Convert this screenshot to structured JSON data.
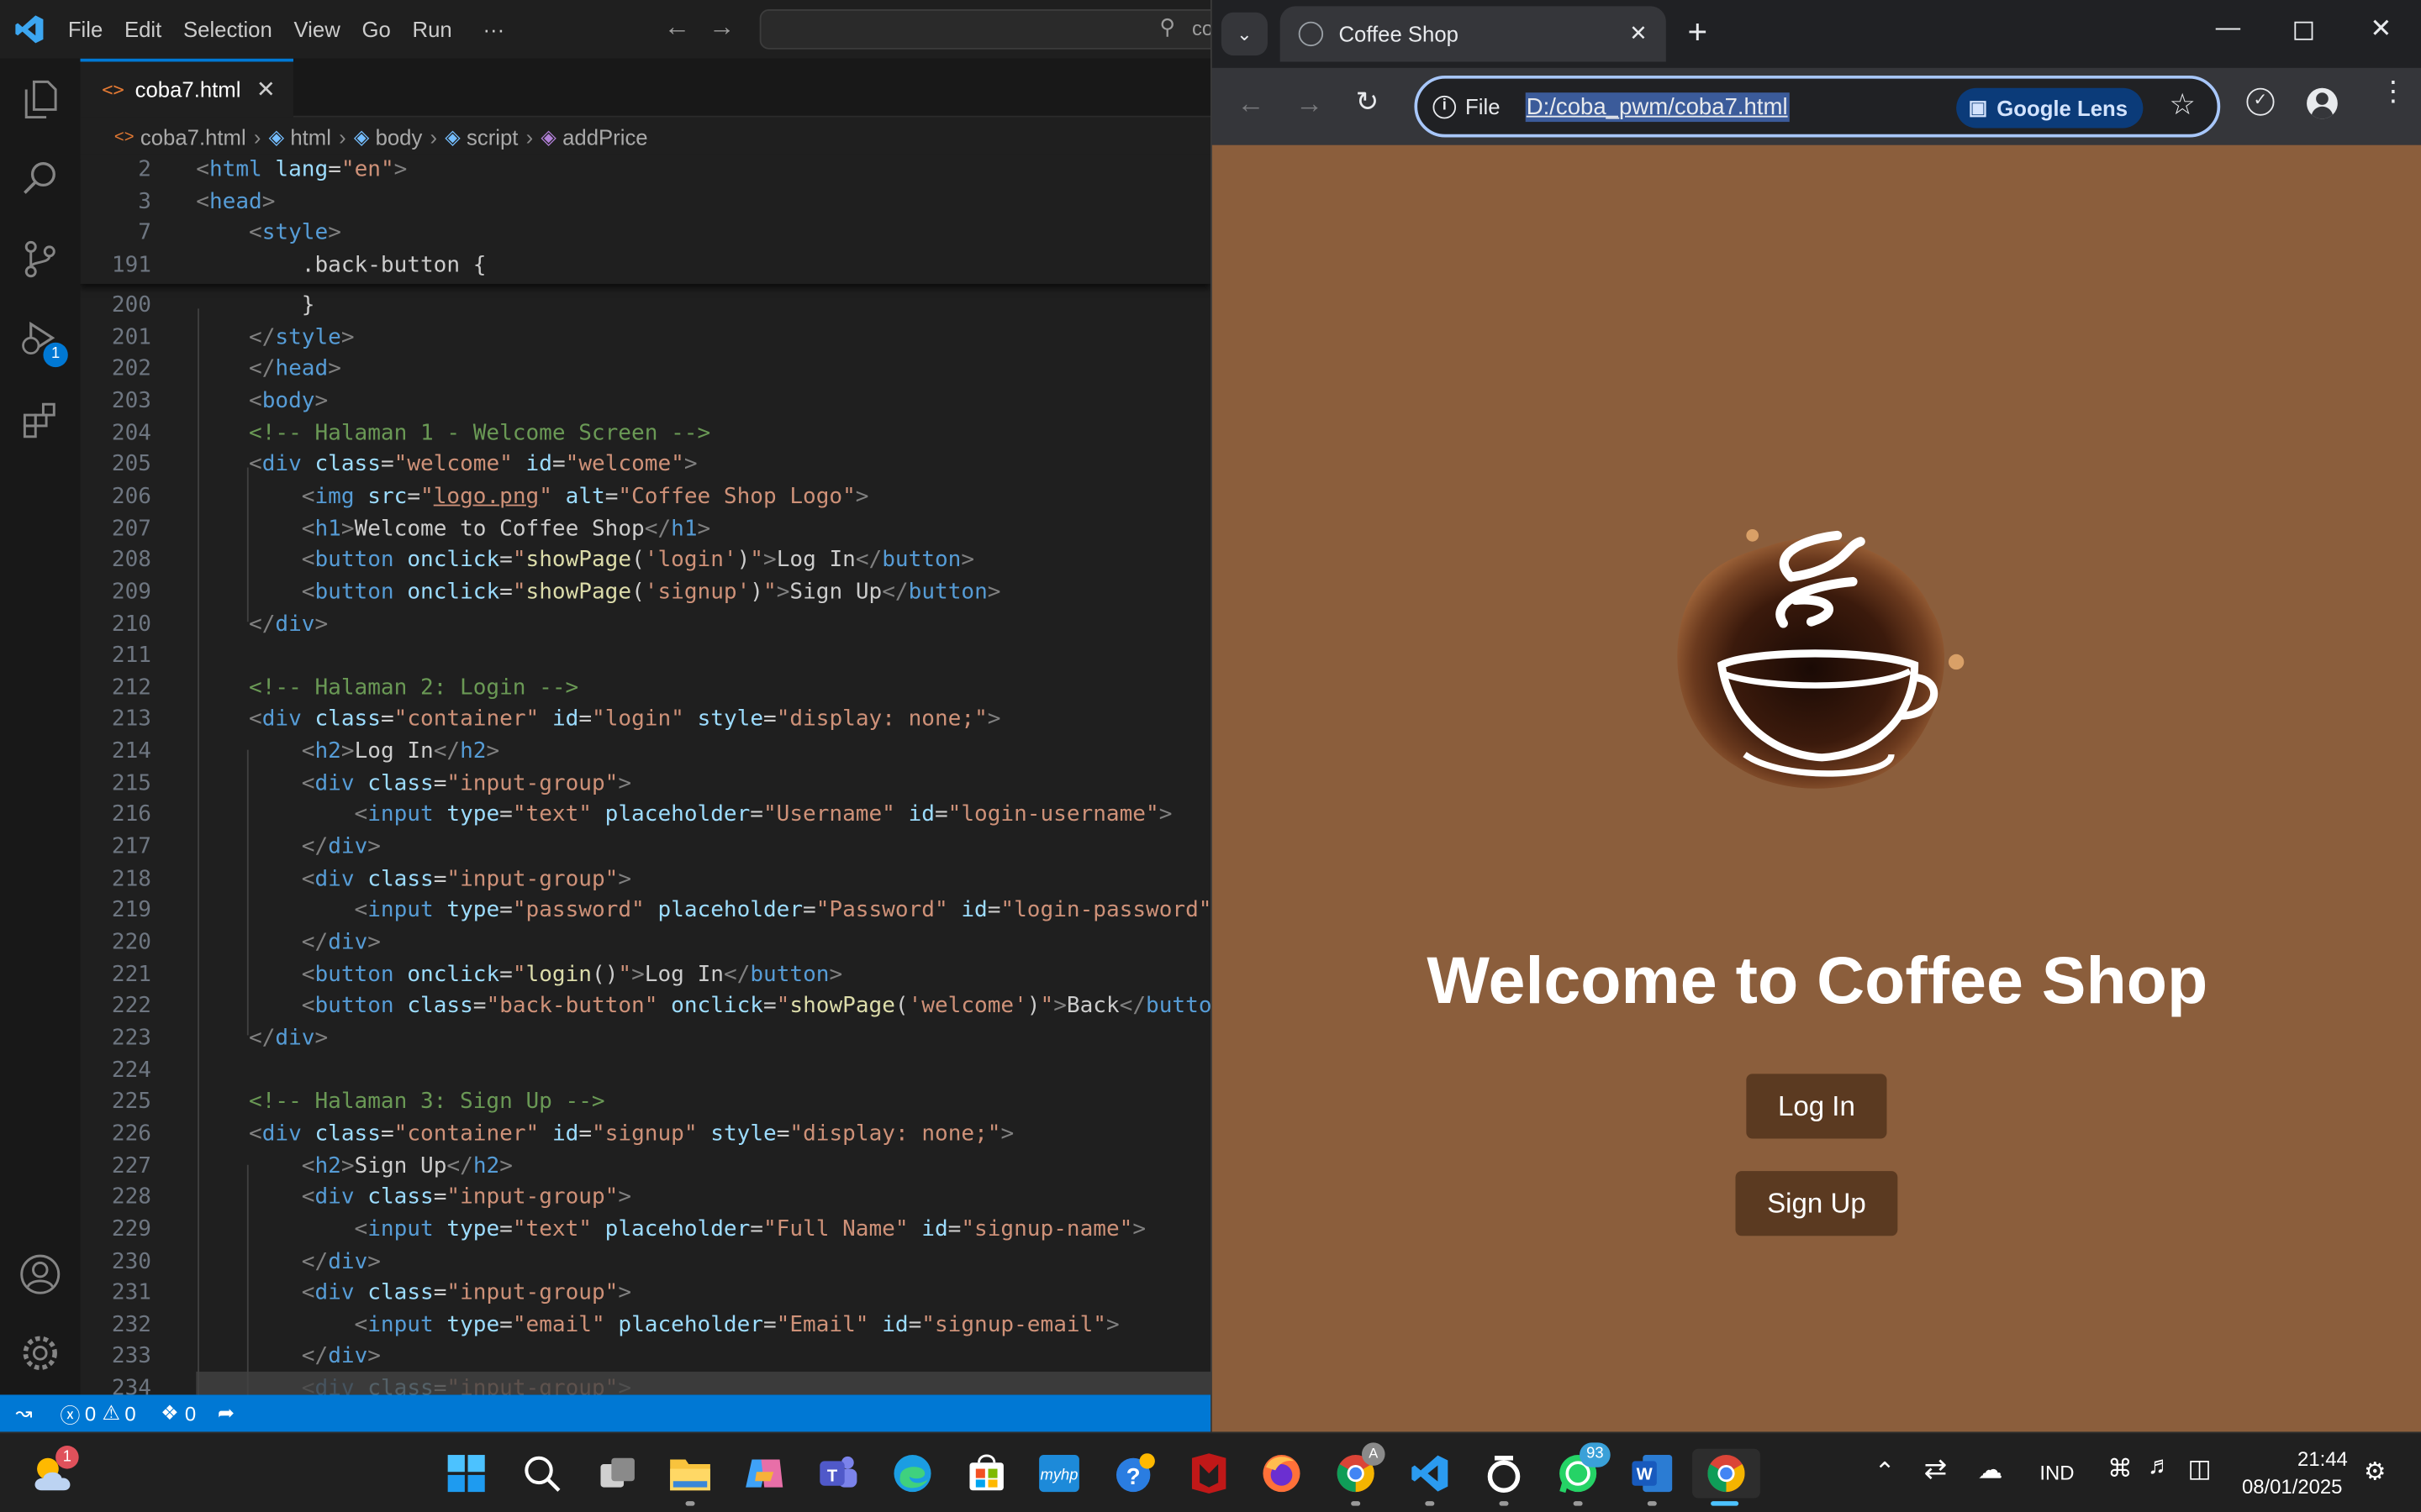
{
  "vscode": {
    "menu": [
      "File",
      "Edit",
      "Selection",
      "View",
      "Go",
      "Run",
      "···"
    ],
    "search_fragment": "co",
    "tab": {
      "label": "coba7.html"
    },
    "breadcrumb": [
      "coba7.html",
      "html",
      "body",
      "script",
      "addPrice"
    ],
    "sticky_lines": [
      {
        "n": "2",
        "html": "<span class=\"g\">&lt;</span><span class=\"t\">html</span> <span class=\"a\">lang</span><span class=\"d\">=</span><span class=\"s\">\"en\"</span><span class=\"g\">&gt;</span>"
      },
      {
        "n": "3",
        "html": "<span class=\"g\">&lt;</span><span class=\"t\">head</span><span class=\"g\">&gt;</span>"
      },
      {
        "n": "7",
        "html": "    <span class=\"g\">&lt;</span><span class=\"t\">style</span><span class=\"g\">&gt;</span>"
      },
      {
        "n": "191",
        "html": "        <span class=\"d\">.back-button {</span>"
      }
    ],
    "lines": [
      {
        "n": "200",
        "html": "        <span class=\"d\">}</span>"
      },
      {
        "n": "201",
        "html": "    <span class=\"g\">&lt;/</span><span class=\"t\">style</span><span class=\"g\">&gt;</span>"
      },
      {
        "n": "202",
        "html": "    <span class=\"g\">&lt;/</span><span class=\"t\">head</span><span class=\"g\">&gt;</span>"
      },
      {
        "n": "203",
        "html": "    <span class=\"g\">&lt;</span><span class=\"t\">body</span><span class=\"g\">&gt;</span>"
      },
      {
        "n": "204",
        "html": "    <span class=\"c\">&lt;!-- Halaman 1 - Welcome Screen --&gt;</span>"
      },
      {
        "n": "205",
        "html": "    <span class=\"g\">&lt;</span><span class=\"t\">div</span> <span class=\"a\">class</span><span class=\"d\">=</span><span class=\"s\">\"welcome\"</span> <span class=\"a\">id</span><span class=\"d\">=</span><span class=\"s\">\"welcome\"</span><span class=\"g\">&gt;</span>"
      },
      {
        "n": "206",
        "html": "        <span class=\"g\">&lt;</span><span class=\"t\">img</span> <span class=\"a\">src</span><span class=\"d\">=</span><span class=\"s\">\"<span class=\"u\">logo.png</span>\"</span> <span class=\"a\">alt</span><span class=\"d\">=</span><span class=\"s\">\"Coffee Shop Logo\"</span><span class=\"g\">&gt;</span>"
      },
      {
        "n": "207",
        "html": "        <span class=\"g\">&lt;</span><span class=\"t\">h1</span><span class=\"g\">&gt;</span><span class=\"d\">Welcome to Coffee Shop</span><span class=\"g\">&lt;/</span><span class=\"t\">h1</span><span class=\"g\">&gt;</span>"
      },
      {
        "n": "208",
        "html": "        <span class=\"g\">&lt;</span><span class=\"t\">button</span> <span class=\"a\">onclick</span><span class=\"d\">=</span><span class=\"s\">\"</span><span class=\"f\">showPage</span><span class=\"d\">(</span><span class=\"s\">'login'</span><span class=\"d\">)</span><span class=\"s\">\"</span><span class=\"g\">&gt;</span><span class=\"d\">Log In</span><span class=\"g\">&lt;/</span><span class=\"t\">button</span><span class=\"g\">&gt;</span>"
      },
      {
        "n": "209",
        "html": "        <span class=\"g\">&lt;</span><span class=\"t\">button</span> <span class=\"a\">onclick</span><span class=\"d\">=</span><span class=\"s\">\"</span><span class=\"f\">showPage</span><span class=\"d\">(</span><span class=\"s\">'signup'</span><span class=\"d\">)</span><span class=\"s\">\"</span><span class=\"g\">&gt;</span><span class=\"d\">Sign Up</span><span class=\"g\">&lt;/</span><span class=\"t\">button</span><span class=\"g\">&gt;</span>"
      },
      {
        "n": "210",
        "html": "    <span class=\"g\">&lt;/</span><span class=\"t\">div</span><span class=\"g\">&gt;</span>"
      },
      {
        "n": "211",
        "html": ""
      },
      {
        "n": "212",
        "html": "    <span class=\"c\">&lt;!-- Halaman 2: Login --&gt;</span>"
      },
      {
        "n": "213",
        "html": "    <span class=\"g\">&lt;</span><span class=\"t\">div</span> <span class=\"a\">class</span><span class=\"d\">=</span><span class=\"s\">\"container\"</span> <span class=\"a\">id</span><span class=\"d\">=</span><span class=\"s\">\"login\"</span> <span class=\"a\">style</span><span class=\"d\">=</span><span class=\"s\">\"display: none;\"</span><span class=\"g\">&gt;</span>"
      },
      {
        "n": "214",
        "html": "        <span class=\"g\">&lt;</span><span class=\"t\">h2</span><span class=\"g\">&gt;</span><span class=\"d\">Log In</span><span class=\"g\">&lt;/</span><span class=\"t\">h2</span><span class=\"g\">&gt;</span>"
      },
      {
        "n": "215",
        "html": "        <span class=\"g\">&lt;</span><span class=\"t\">div</span> <span class=\"a\">class</span><span class=\"d\">=</span><span class=\"s\">\"input-group\"</span><span class=\"g\">&gt;</span>"
      },
      {
        "n": "216",
        "html": "            <span class=\"g\">&lt;</span><span class=\"t\">input</span> <span class=\"a\">type</span><span class=\"d\">=</span><span class=\"s\">\"text\"</span> <span class=\"a\">placeholder</span><span class=\"d\">=</span><span class=\"s\">\"Username\"</span> <span class=\"a\">id</span><span class=\"d\">=</span><span class=\"s\">\"login-username\"</span><span class=\"g\">&gt;</span>"
      },
      {
        "n": "217",
        "html": "        <span class=\"g\">&lt;/</span><span class=\"t\">div</span><span class=\"g\">&gt;</span>"
      },
      {
        "n": "218",
        "html": "        <span class=\"g\">&lt;</span><span class=\"t\">div</span> <span class=\"a\">class</span><span class=\"d\">=</span><span class=\"s\">\"input-group\"</span><span class=\"g\">&gt;</span>"
      },
      {
        "n": "219",
        "html": "            <span class=\"g\">&lt;</span><span class=\"t\">input</span> <span class=\"a\">type</span><span class=\"d\">=</span><span class=\"s\">\"password\"</span> <span class=\"a\">placeholder</span><span class=\"d\">=</span><span class=\"s\">\"Password\"</span> <span class=\"a\">id</span><span class=\"d\">=</span><span class=\"s\">\"login-password\"</span><span class=\"g\">&gt;</span>"
      },
      {
        "n": "220",
        "html": "        <span class=\"g\">&lt;/</span><span class=\"t\">div</span><span class=\"g\">&gt;</span>"
      },
      {
        "n": "221",
        "html": "        <span class=\"g\">&lt;</span><span class=\"t\">button</span> <span class=\"a\">onclick</span><span class=\"d\">=</span><span class=\"s\">\"</span><span class=\"f\">login</span><span class=\"d\">()</span><span class=\"s\">\"</span><span class=\"g\">&gt;</span><span class=\"d\">Log In</span><span class=\"g\">&lt;/</span><span class=\"t\">button</span><span class=\"g\">&gt;</span>"
      },
      {
        "n": "222",
        "html": "        <span class=\"g\">&lt;</span><span class=\"t\">button</span> <span class=\"a\">class</span><span class=\"d\">=</span><span class=\"s\">\"back-button\"</span> <span class=\"a\">onclick</span><span class=\"d\">=</span><span class=\"s\">\"</span><span class=\"f\">showPage</span><span class=\"d\">(</span><span class=\"s\">'welcome'</span><span class=\"d\">)</span><span class=\"s\">\"</span><span class=\"g\">&gt;</span><span class=\"d\">Back</span><span class=\"g\">&lt;/</span><span class=\"t\">button</span><span class=\"g\">&gt;</span>"
      },
      {
        "n": "223",
        "html": "    <span class=\"g\">&lt;/</span><span class=\"t\">div</span><span class=\"g\">&gt;</span>"
      },
      {
        "n": "224",
        "html": ""
      },
      {
        "n": "225",
        "html": "    <span class=\"c\">&lt;!-- Halaman 3: Sign Up --&gt;</span>"
      },
      {
        "n": "226",
        "html": "    <span class=\"g\">&lt;</span><span class=\"t\">div</span> <span class=\"a\">class</span><span class=\"d\">=</span><span class=\"s\">\"container\"</span> <span class=\"a\">id</span><span class=\"d\">=</span><span class=\"s\">\"signup\"</span> <span class=\"a\">style</span><span class=\"d\">=</span><span class=\"s\">\"display: none;\"</span><span class=\"g\">&gt;</span>"
      },
      {
        "n": "227",
        "html": "        <span class=\"g\">&lt;</span><span class=\"t\">h2</span><span class=\"g\">&gt;</span><span class=\"d\">Sign Up</span><span class=\"g\">&lt;/</span><span class=\"t\">h2</span><span class=\"g\">&gt;</span>"
      },
      {
        "n": "228",
        "html": "        <span class=\"g\">&lt;</span><span class=\"t\">div</span> <span class=\"a\">class</span><span class=\"d\">=</span><span class=\"s\">\"input-group\"</span><span class=\"g\">&gt;</span>"
      },
      {
        "n": "229",
        "html": "            <span class=\"g\">&lt;</span><span class=\"t\">input</span> <span class=\"a\">type</span><span class=\"d\">=</span><span class=\"s\">\"text\"</span> <span class=\"a\">placeholder</span><span class=\"d\">=</span><span class=\"s\">\"Full Name\"</span> <span class=\"a\">id</span><span class=\"d\">=</span><span class=\"s\">\"signup-name\"</span><span class=\"g\">&gt;</span>"
      },
      {
        "n": "230",
        "html": "        <span class=\"g\">&lt;/</span><span class=\"t\">div</span><span class=\"g\">&gt;</span>"
      },
      {
        "n": "231",
        "html": "        <span class=\"g\">&lt;</span><span class=\"t\">div</span> <span class=\"a\">class</span><span class=\"d\">=</span><span class=\"s\">\"input-group\"</span><span class=\"g\">&gt;</span>"
      },
      {
        "n": "232",
        "html": "            <span class=\"g\">&lt;</span><span class=\"t\">input</span> <span class=\"a\">type</span><span class=\"d\">=</span><span class=\"s\">\"email\"</span> <span class=\"a\">placeholder</span><span class=\"d\">=</span><span class=\"s\">\"Email\"</span> <span class=\"a\">id</span><span class=\"d\">=</span><span class=\"s\">\"signup-email\"</span><span class=\"g\">&gt;</span>"
      },
      {
        "n": "233",
        "html": "        <span class=\"g\">&lt;/</span><span class=\"t\">div</span><span class=\"g\">&gt;</span>"
      },
      {
        "n": "234",
        "html": "        <span class=\"g\">&lt;</span><span class=\"t\">div</span> <span class=\"a\">class</span><span class=\"d\">=</span><span class=\"s\">\"input-group\"</span><span class=\"g\">&gt;</span>"
      }
    ],
    "status": {
      "errors": "0",
      "warnings": "0",
      "ports": "0"
    },
    "run_badge": "1"
  },
  "browser": {
    "tab_title": "Coffee Shop",
    "omnibox": {
      "scheme_label": "File",
      "url": "D:/coba_pwm/coba7.html",
      "lens_label": "Google Lens"
    },
    "page": {
      "heading": "Welcome to Coffee Shop",
      "login_button": "Log In",
      "signup_button": "Sign Up",
      "bg_color": "#8b5e3c",
      "button_color": "#5b3a21"
    }
  },
  "taskbar": {
    "weather_badge": "1",
    "whatsapp_badge": "93",
    "chrome_profile_badge": "A",
    "language": "IND",
    "time": "21:44",
    "date": "08/01/2025"
  }
}
